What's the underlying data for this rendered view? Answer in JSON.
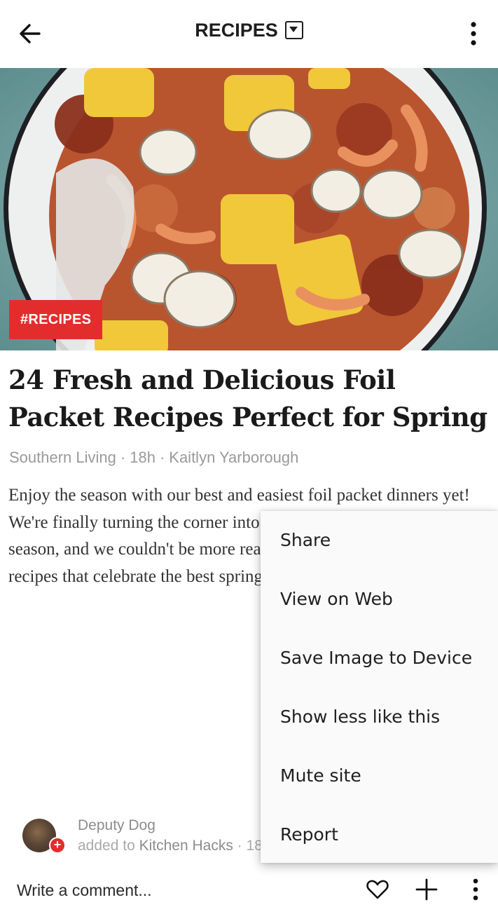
{
  "header": {
    "title": "RECIPES",
    "back_icon": "arrow-left-icon",
    "dropdown_icon": "caret-down-box-icon",
    "menu_icon": "more-vertical-icon"
  },
  "hero": {
    "tag": "#RECIPES",
    "tag_color": "#e32d2d"
  },
  "article": {
    "headline": "24 Fresh and Delicious Foil Packet Recipes Perfect for Spring",
    "source": "Southern Living",
    "age": "18h",
    "author": "Kaitlyn Yarborough",
    "excerpt": "Enjoy the season with our best and easiest foil packet dinners yet! We're finally turning the corner into the bright and blooming season, and we couldn't be more ready for fresh, perfectly easy recipes that celebrate the best spring has to ..."
  },
  "attribution": {
    "user": "Deputy Dog",
    "action": "added to",
    "magazine": "Kitchen Hacks",
    "age": "18h"
  },
  "comment": {
    "placeholder": "Write a comment..."
  },
  "context_menu": {
    "items": [
      "Share",
      "View on Web",
      "Save Image to Device",
      "Show less like this",
      "Mute site",
      "Report"
    ]
  },
  "colors": {
    "accent": "#e32d2d",
    "meta": "#9a9a9a",
    "menu_bg": "#fafafa"
  }
}
